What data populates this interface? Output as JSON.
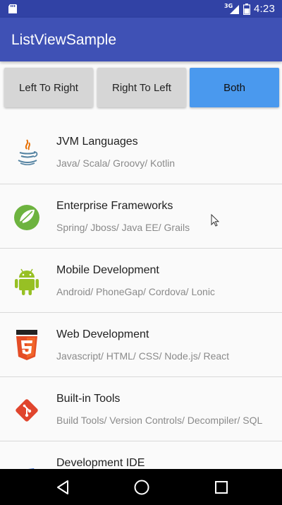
{
  "status_bar": {
    "time": "4:23",
    "network_label": "3G",
    "icons": [
      "notification-sd-icon",
      "signal-icon",
      "battery-icon"
    ]
  },
  "app_bar": {
    "title": "ListViewSample",
    "color": "#3f51b5",
    "status_color": "#3142a5"
  },
  "buttons": [
    {
      "label": "Left To Right",
      "active": false
    },
    {
      "label": "Right To Left",
      "active": false
    },
    {
      "label": "Both",
      "active": true
    }
  ],
  "accent": "#4a99ee",
  "list": {
    "items": [
      {
        "title": "JVM Languages",
        "subtitle": "Java/ Scala/ Groovy/ Kotlin",
        "icon": "java-icon"
      },
      {
        "title": "Enterprise Frameworks",
        "subtitle": "Spring/ Jboss/ Java EE/ Grails",
        "icon": "spring-icon"
      },
      {
        "title": "Mobile Development",
        "subtitle": "Android/ PhoneGap/ Cordova/ Lonic",
        "icon": "android-icon"
      },
      {
        "title": "Web Development",
        "subtitle": "Javascript/ HTML/ CSS/ Node.js/ React",
        "icon": "html5-icon"
      },
      {
        "title": "Built-in Tools",
        "subtitle": "Build Tools/ Version Controls/ Decompiler/ SQL",
        "icon": "git-icon"
      },
      {
        "title": "Development IDE",
        "subtitle": "",
        "icon": "ide-icon"
      }
    ]
  },
  "nav_bar": {
    "icons": [
      "back-icon",
      "home-icon",
      "recents-icon"
    ]
  }
}
